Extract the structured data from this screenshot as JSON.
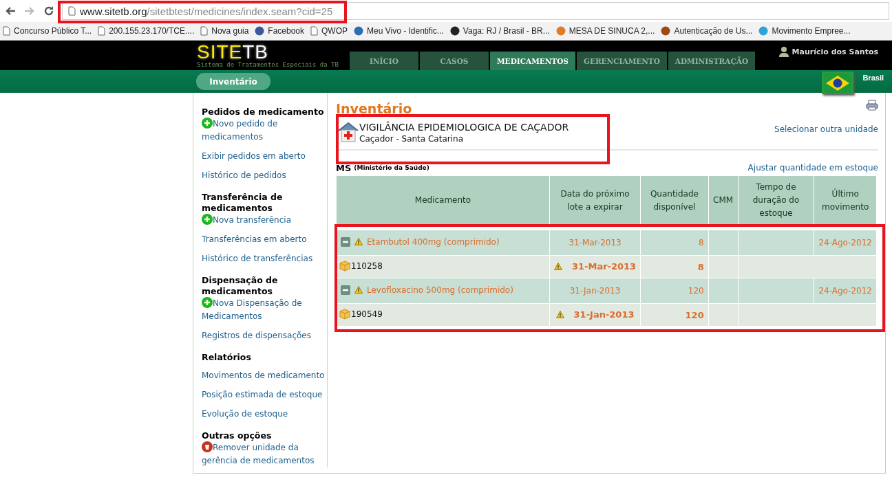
{
  "browser": {
    "url_host": "www.sitetb.org",
    "url_path": "/sitetbtest/medicines/index.seam?cid=25",
    "highlighted": true,
    "bookmarks": [
      {
        "label": "Concurso Público T...",
        "kind": "page"
      },
      {
        "label": "200.155.23.170/TCE....",
        "kind": "page"
      },
      {
        "label": "Nova guia",
        "kind": "page"
      },
      {
        "label": "Facebook",
        "kind": "site",
        "color": "#3b5998"
      },
      {
        "label": "QWOP",
        "kind": "page"
      },
      {
        "label": "Meu Vivo - Identific...",
        "kind": "site",
        "color": "#2a6fb0"
      },
      {
        "label": "Vaga: RJ / Brasil - BR...",
        "kind": "site",
        "color": "#222222"
      },
      {
        "label": "MESA DE SINUCA 2,...",
        "kind": "site",
        "color": "#e07b2a"
      },
      {
        "label": "Autenticação de Us...",
        "kind": "site",
        "color": "#9a4a12"
      },
      {
        "label": "Movimento Empree...",
        "kind": "site",
        "color": "#2fa3d8"
      }
    ]
  },
  "header": {
    "logo_prefix": "SITE",
    "logo_suffix": "TB",
    "tagline": "Sistema de Tratamentos Especiais da TB",
    "tabs": [
      {
        "label": "INÍCIO",
        "selected": false
      },
      {
        "label": "CASOS",
        "selected": false
      },
      {
        "label": "MEDICAMENTOS",
        "selected": true
      },
      {
        "label": "GERENCIAMENTO",
        "selected": false
      },
      {
        "label": "ADMINISTRAÇÃO",
        "selected": false
      }
    ],
    "user": "Maurício dos Santos",
    "country": "Brasil",
    "subnav": "Inventário"
  },
  "sidebar": [
    {
      "title": "Pedidos de medicamento",
      "links": [
        {
          "label": "Novo pedido de medicamentos",
          "kind": "add"
        },
        {
          "label": "Exibir pedidos em aberto",
          "kind": "plain"
        },
        {
          "label": "Histórico de pedidos",
          "kind": "plain"
        }
      ]
    },
    {
      "title": "Transferência de medicamentos",
      "links": [
        {
          "label": "Nova transferência",
          "kind": "add"
        },
        {
          "label": "Transferências em aberto",
          "kind": "plain"
        },
        {
          "label": "Histórico de transferências",
          "kind": "plain"
        }
      ]
    },
    {
      "title": "Dispensação de medicamentos",
      "links": [
        {
          "label": "Nova Dispensação de Medicamentos",
          "kind": "add"
        },
        {
          "label": "Registros de dispensações",
          "kind": "plain"
        }
      ]
    },
    {
      "title": "Relatórios",
      "links": [
        {
          "label": "Movimentos de medicamento",
          "kind": "plain"
        },
        {
          "label": "Posição estimada de estoque",
          "kind": "plain"
        },
        {
          "label": "Evolução de estoque",
          "kind": "plain"
        }
      ]
    },
    {
      "title": "Outras opções",
      "links": [
        {
          "label": "Remover unidade da gerência de medicamentos",
          "kind": "remove"
        }
      ]
    }
  ],
  "main": {
    "title": "Inventário",
    "unit": {
      "name": "VIGILÂNCIA EPIDEMIOLOGICA DE CAÇADOR",
      "location": "Caçador - Santa Catarina",
      "highlighted": true
    },
    "select_unit": "Selecionar outra unidade",
    "source": "MS",
    "source_detail": "(Ministério da Saúde)",
    "adjust": "Ajustar quantidade em estoque",
    "table": {
      "highlighted": true,
      "columns": [
        "Medicamento",
        "Data do próximo lote a expirar",
        "Quantidade disponível",
        "CMM",
        "Tempo de duração do estoque",
        "Último movimento"
      ],
      "rows": [
        {
          "name": "Etambutol 400mg (comprimido)",
          "expiry": "31-Mar-2013",
          "quantity": "8",
          "last_movement": "24-Ago-2012",
          "expanded": true,
          "warning": true,
          "batches": [
            {
              "batch": "110258",
              "expiry": "31-Mar-2013",
              "quantity": "8",
              "warning": true
            }
          ]
        },
        {
          "name": "Levofloxacino 500mg (comprimido)",
          "expiry": "31-Jan-2013",
          "quantity": "120",
          "last_movement": "24-Ago-2012",
          "expanded": true,
          "warning": true,
          "batches": [
            {
              "batch": "190549",
              "expiry": "31-Jan-2013",
              "quantity": "120",
              "warning": true
            }
          ]
        }
      ]
    }
  }
}
